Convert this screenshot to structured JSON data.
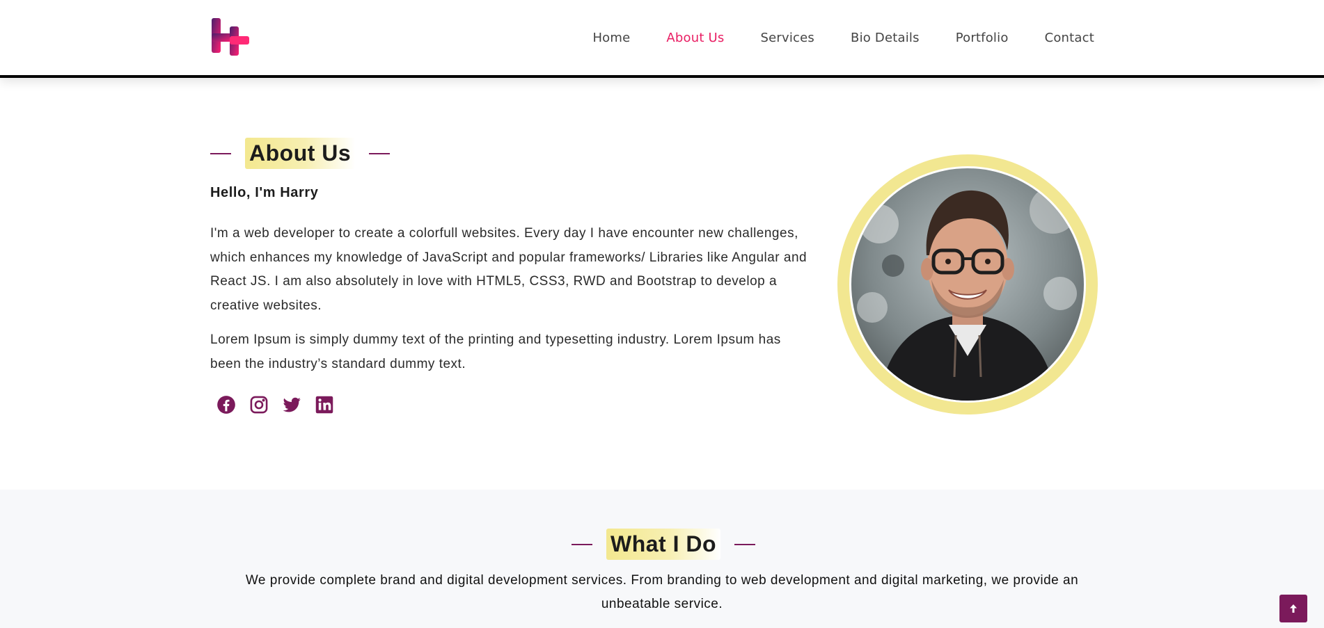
{
  "header": {
    "logo_icon": "h-plus-logo",
    "nav": [
      {
        "label": "Home",
        "active": false
      },
      {
        "label": "About Us",
        "active": true
      },
      {
        "label": "Services",
        "active": false
      },
      {
        "label": "Bio Details",
        "active": false
      },
      {
        "label": "Portfolio",
        "active": false
      },
      {
        "label": "Contact",
        "active": false
      }
    ]
  },
  "about": {
    "title": "About Us",
    "greeting": "Hello, I'm Harry",
    "paragraph1": "I'm a web developer to create a colorfull websites. Every day I have encounter new challenges, which enhances my knowledge of JavaScript and popular frameworks/ Libraries like Angular and React JS. I am also absolutely in love with HTML5, CSS3, RWD and Bootstrap to develop a creative websites.",
    "paragraph2": "Lorem Ipsum is simply dummy text of the printing and typesetting industry. Lorem Ipsum has been the industry’s standard dummy text.",
    "social_icons": [
      "facebook-icon",
      "instagram-icon",
      "twitter-icon",
      "linkedin-icon"
    ],
    "photo_icon": "profile-photo"
  },
  "what_i_do": {
    "title": "What I Do",
    "description": "We provide complete brand and digital development services. From branding to web development and digital marketing, we provide an unbeatable service."
  },
  "scroll_top_icon": "arrow-up-icon",
  "colors": {
    "accent": "#e91e63",
    "brand_purple": "#7b1a5b",
    "highlight_yellow": "#f2e791",
    "section_bg": "#f7f8fa"
  }
}
